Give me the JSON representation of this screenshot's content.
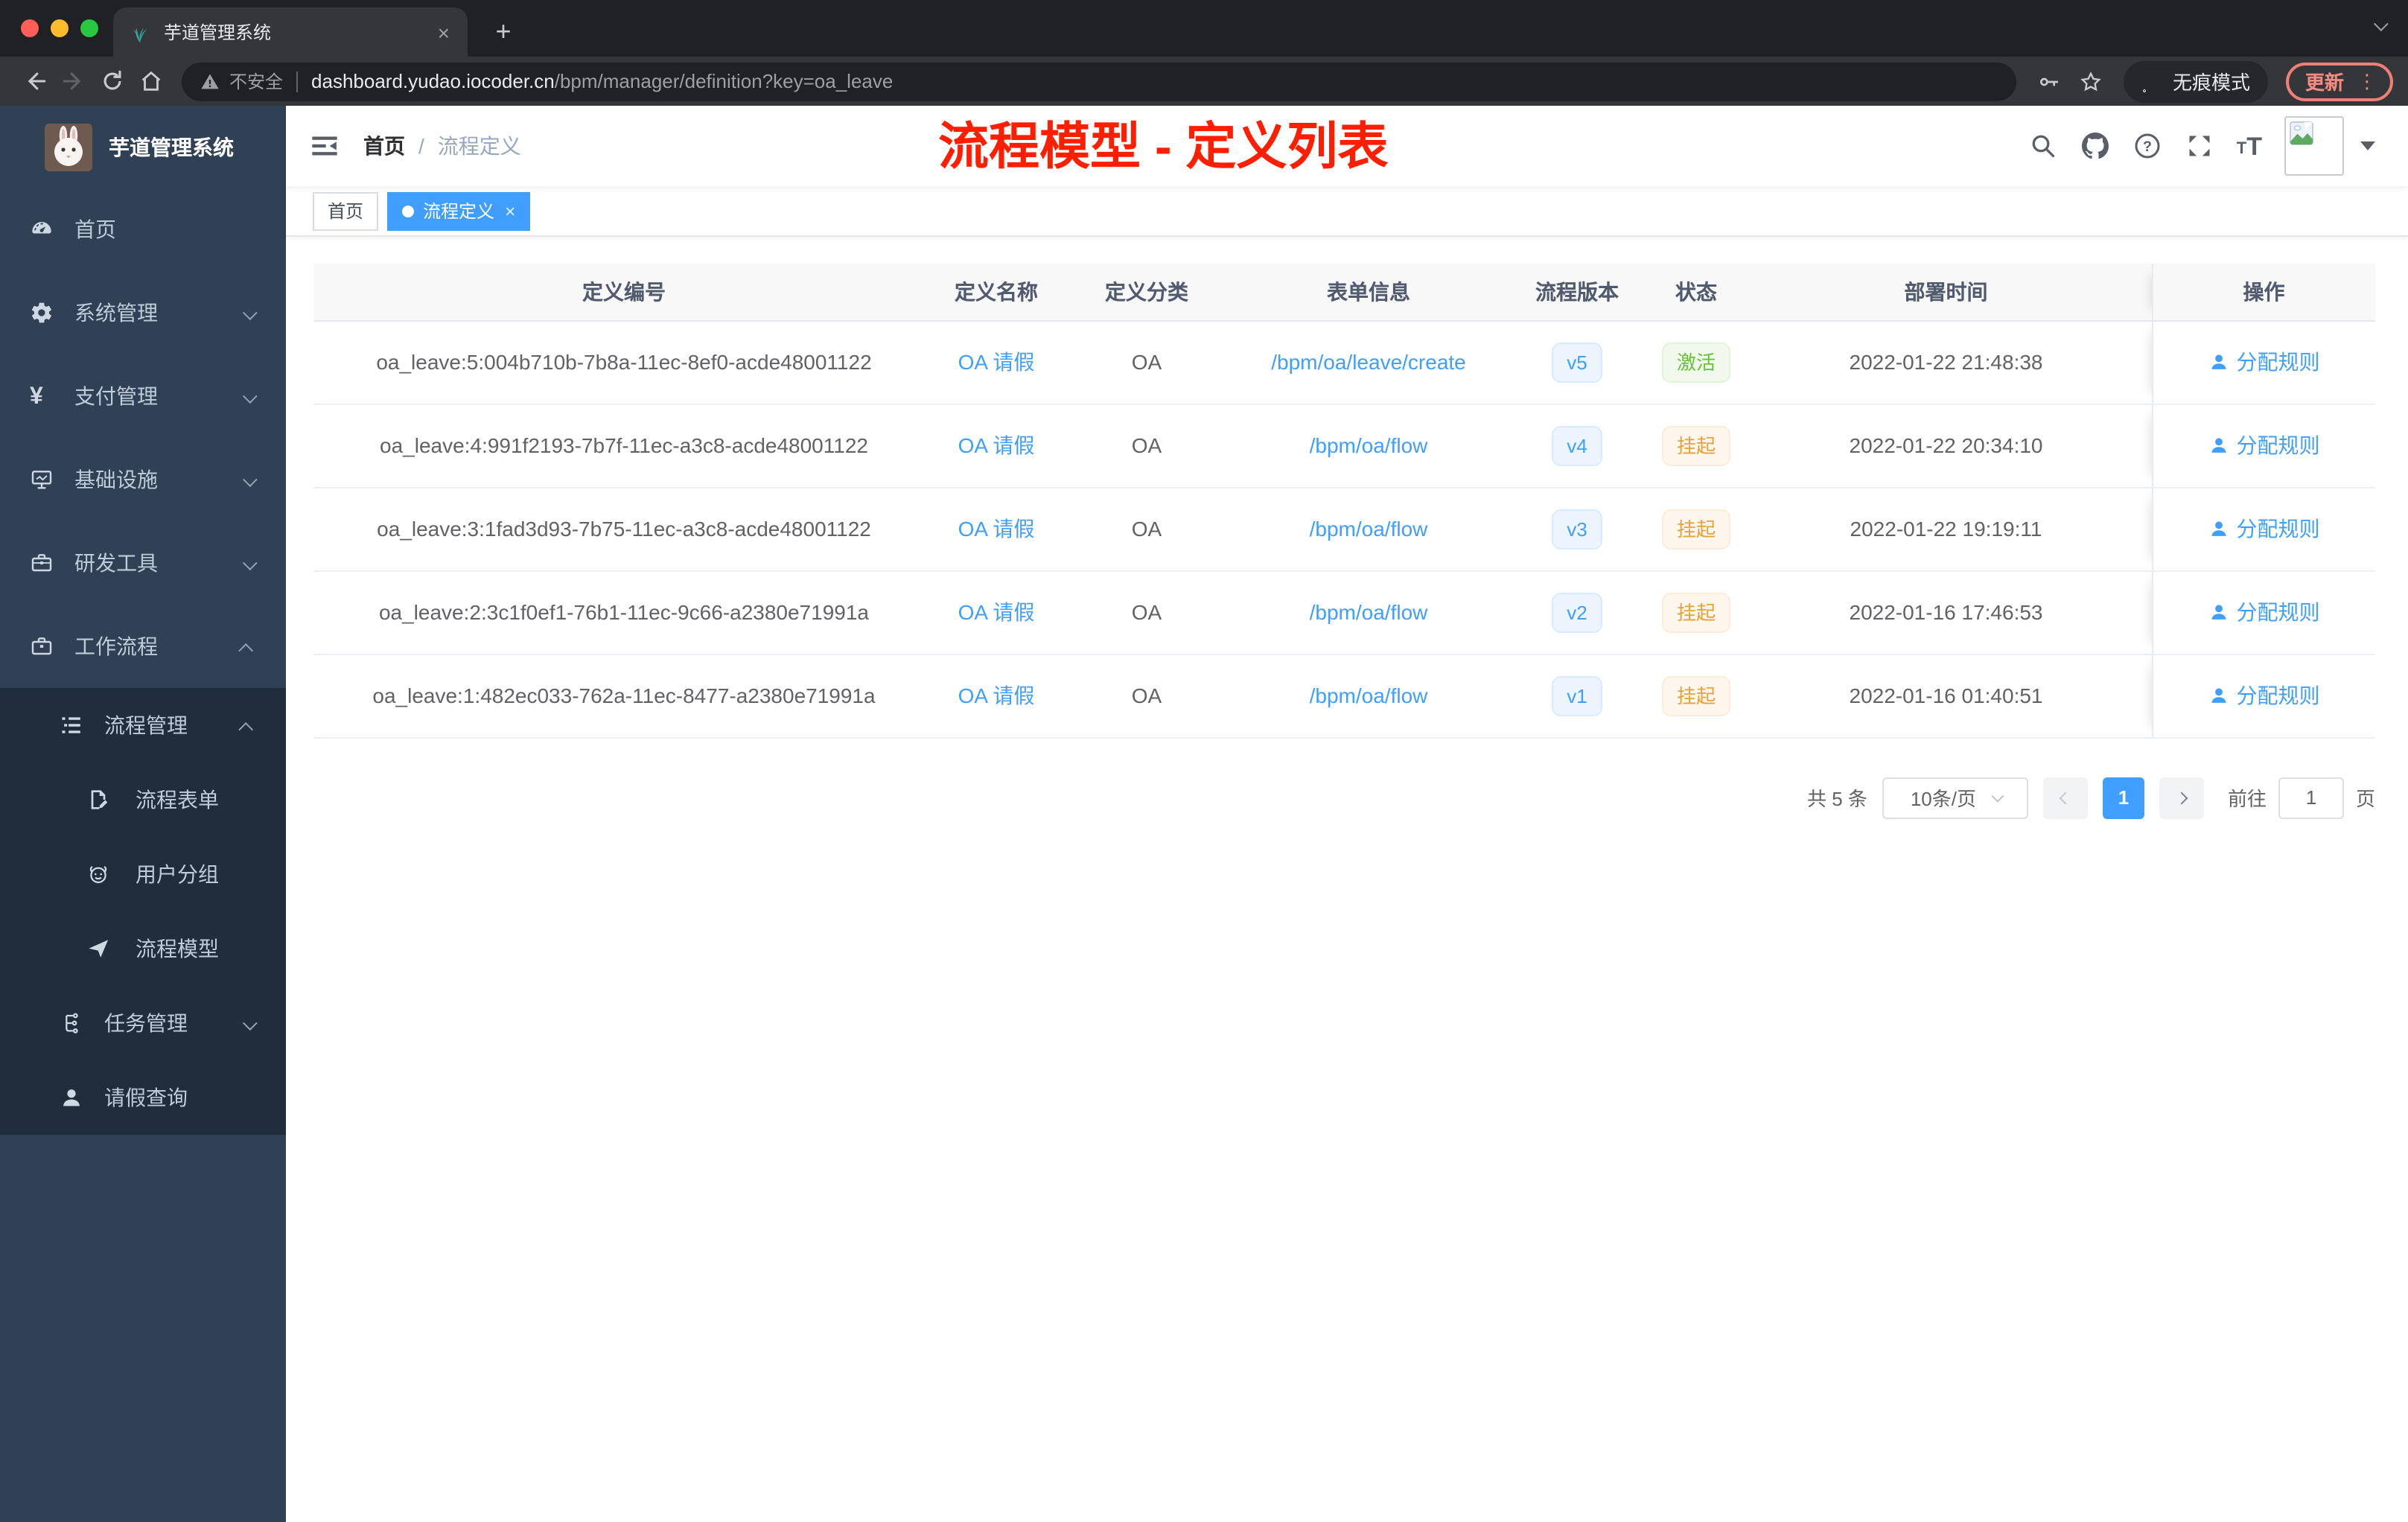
{
  "browser": {
    "tab": {
      "title": "芋道管理系统",
      "close_glyph": "×"
    },
    "new_tab_glyph": "+",
    "security_label": "不安全",
    "url_host": "dashboard.yudao.iocoder.cn",
    "url_path": "/bpm/manager/definition?key=oa_leave",
    "incognito_label": "无痕模式",
    "update_label": "更新",
    "kebab_glyph": "⋮"
  },
  "sidebar": {
    "title": "芋道管理系统",
    "menu": [
      {
        "key": "home",
        "label": "首页",
        "icon": "dashboard"
      },
      {
        "key": "system-management",
        "label": "系统管理",
        "icon": "gear",
        "arrow": "down"
      },
      {
        "key": "payment-management",
        "label": "支付管理",
        "icon": "yen",
        "arrow": "down"
      },
      {
        "key": "infrastructure",
        "label": "基础设施",
        "icon": "monitor",
        "arrow": "down"
      },
      {
        "key": "dev-tools",
        "label": "研发工具",
        "icon": "toolbox",
        "arrow": "down"
      },
      {
        "key": "workflow",
        "label": "工作流程",
        "icon": "briefcase",
        "arrow": "up"
      }
    ],
    "submenu": [
      {
        "key": "process-management",
        "label": "流程管理",
        "icon": "list",
        "arrow": "up",
        "level": 2
      },
      {
        "key": "process-form",
        "label": "流程表单",
        "icon": "form",
        "level": 3
      },
      {
        "key": "user-group",
        "label": "用户分组",
        "icon": "robot",
        "level": 3
      },
      {
        "key": "process-model",
        "label": "流程模型",
        "icon": "plane",
        "level": 3
      },
      {
        "key": "task-management",
        "label": "任务管理",
        "icon": "tree",
        "arrow": "down",
        "level": 2
      },
      {
        "key": "leave-query",
        "label": "请假查询",
        "icon": "user",
        "level": 2
      }
    ]
  },
  "navbar": {
    "breadcrumb": [
      "首页",
      "流程定义"
    ],
    "separator": "/"
  },
  "annotation": "流程模型 - 定义列表",
  "tags": [
    {
      "label": "首页",
      "active": false
    },
    {
      "label": "流程定义",
      "active": true,
      "close_glyph": "×"
    }
  ],
  "table": {
    "columns": [
      "定义编号",
      "定义名称",
      "定义分类",
      "表单信息",
      "流程版本",
      "状态",
      "部署时间",
      "操作"
    ],
    "rows": [
      {
        "id": "oa_leave:5:004b710b-7b8a-11ec-8ef0-acde48001122",
        "name": "OA 请假",
        "category": "OA",
        "form": "/bpm/oa/leave/create",
        "version": "v5",
        "status": "激活",
        "status_type": "success",
        "time": "2022-01-22 21:48:38",
        "action": "分配规则"
      },
      {
        "id": "oa_leave:4:991f2193-7b7f-11ec-a3c8-acde48001122",
        "name": "OA 请假",
        "category": "OA",
        "form": "/bpm/oa/flow",
        "version": "v4",
        "status": "挂起",
        "status_type": "warning",
        "time": "2022-01-22 20:34:10",
        "action": "分配规则"
      },
      {
        "id": "oa_leave:3:1fad3d93-7b75-11ec-a3c8-acde48001122",
        "name": "OA 请假",
        "category": "OA",
        "form": "/bpm/oa/flow",
        "version": "v3",
        "status": "挂起",
        "status_type": "warning",
        "time": "2022-01-22 19:19:11",
        "action": "分配规则"
      },
      {
        "id": "oa_leave:2:3c1f0ef1-76b1-11ec-9c66-a2380e71991a",
        "name": "OA 请假",
        "category": "OA",
        "form": "/bpm/oa/flow",
        "version": "v2",
        "status": "挂起",
        "status_type": "warning",
        "time": "2022-01-16 17:46:53",
        "action": "分配规则"
      },
      {
        "id": "oa_leave:1:482ec033-762a-11ec-8477-a2380e71991a",
        "name": "OA 请假",
        "category": "OA",
        "form": "/bpm/oa/flow",
        "version": "v1",
        "status": "挂起",
        "status_type": "warning",
        "time": "2022-01-16 01:40:51",
        "action": "分配规则"
      }
    ]
  },
  "pagination": {
    "total": "共 5 条",
    "page_size": "10条/页",
    "page": "1",
    "goto_prefix": "前往",
    "goto_value": "1",
    "goto_suffix": "页"
  },
  "colors": {
    "accent": "#409eff",
    "success": "#67c23a",
    "warning": "#e6a23c",
    "annotation": "#ff1e00",
    "sidebar": "#304156",
    "sidebar-dark": "#1f2d3d"
  }
}
